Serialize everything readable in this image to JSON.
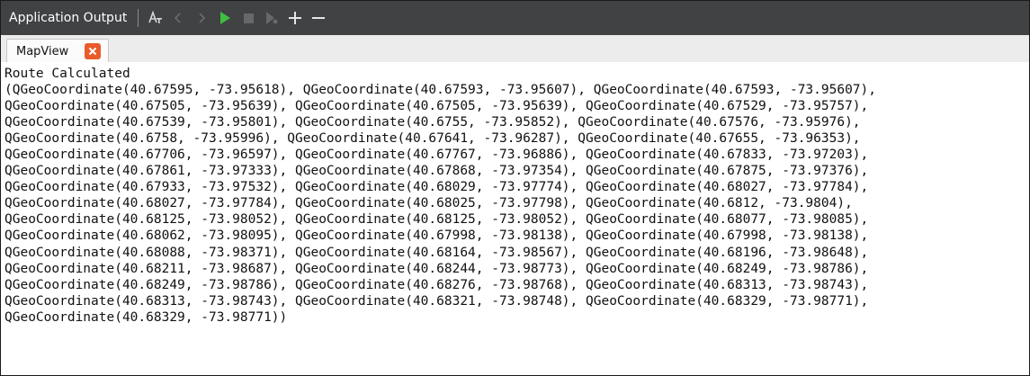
{
  "toolbar": {
    "title": "Application Output",
    "icons": [
      "filter-icon",
      "back-icon",
      "forward-icon",
      "run-icon",
      "stop-icon",
      "attach-debugger-icon",
      "zoom-in-icon",
      "zoom-out-icon"
    ],
    "colors": {
      "background": "#404244",
      "run": "#3fbf3f",
      "text": "#ffffff"
    }
  },
  "tab": {
    "label": "MapView",
    "close_icon": "close-icon",
    "close_color": "#ea5b2c"
  },
  "output": {
    "lines": [
      "Route Calculated",
      "(QGeoCoordinate(40.67595, -73.95618), QGeoCoordinate(40.67593, -73.95607), QGeoCoordinate(40.67593, -73.95607),",
      "QGeoCoordinate(40.67505, -73.95639), QGeoCoordinate(40.67505, -73.95639), QGeoCoordinate(40.67529, -73.95757),",
      "QGeoCoordinate(40.67539, -73.95801), QGeoCoordinate(40.6755, -73.95852), QGeoCoordinate(40.67576, -73.95976),",
      "QGeoCoordinate(40.6758, -73.95996), QGeoCoordinate(40.67641, -73.96287), QGeoCoordinate(40.67655, -73.96353),",
      "QGeoCoordinate(40.67706, -73.96597), QGeoCoordinate(40.67767, -73.96886), QGeoCoordinate(40.67833, -73.97203),",
      "QGeoCoordinate(40.67861, -73.97333), QGeoCoordinate(40.67868, -73.97354), QGeoCoordinate(40.67875, -73.97376),",
      "QGeoCoordinate(40.67933, -73.97532), QGeoCoordinate(40.68029, -73.97774), QGeoCoordinate(40.68027, -73.97784),",
      "QGeoCoordinate(40.68027, -73.97784), QGeoCoordinate(40.68025, -73.97798), QGeoCoordinate(40.6812, -73.9804),",
      "QGeoCoordinate(40.68125, -73.98052), QGeoCoordinate(40.68125, -73.98052), QGeoCoordinate(40.68077, -73.98085),",
      "QGeoCoordinate(40.68062, -73.98095), QGeoCoordinate(40.67998, -73.98138), QGeoCoordinate(40.67998, -73.98138),",
      "QGeoCoordinate(40.68088, -73.98371), QGeoCoordinate(40.68164, -73.98567), QGeoCoordinate(40.68196, -73.98648),",
      "QGeoCoordinate(40.68211, -73.98687), QGeoCoordinate(40.68244, -73.98773), QGeoCoordinate(40.68249, -73.98786),",
      "QGeoCoordinate(40.68249, -73.98786), QGeoCoordinate(40.68276, -73.98768), QGeoCoordinate(40.68313, -73.98743),",
      "QGeoCoordinate(40.68313, -73.98743), QGeoCoordinate(40.68321, -73.98748), QGeoCoordinate(40.68329, -73.98771),",
      "QGeoCoordinate(40.68329, -73.98771))"
    ]
  }
}
